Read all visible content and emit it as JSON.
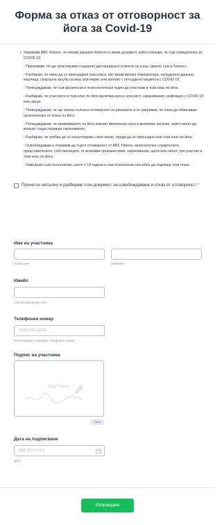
{
  "form": {
    "title": "Форма за отказ от отговорност за йога за Covid-19",
    "waiver": [
      "Уверявам ABC Fitness, че нямам заразни болести и имам документ, който показва, че съм отрицателен за COVID-19.",
      "- Признавам, че ще практикувам социално дистанциране и миене на ръце, докато съм в близост.",
      "- Разбирам, че няма да се присъединя към класа, ако имам висока температура, затруднено дишане, кашлица, скорошна загуба на вкус или мирис или контакт с потърдени пациенти с COVID-19.",
      "- Потвърждавам, че съм физически и психологически годен да участвам в този клас по йога.",
      "- Разбирам, че участието в този клас по йога включва риск и опасност, наранявания, инфекция с COVID-19 или смърт.",
      "- Потвърждавам, че ще поема пълната отговорност за рисковете и се уверявам, че няма да обвинявам организатора от класа по йога.",
      "- Потвърждавам, че занимаването по йога изисквт физическа сила и включват рискове, които могат да влошат съществуващи наранявания.",
      "- Разбирам, че трябва да се консултирам с моя лекар, преди да се присъедня към този клас по йога.",
      "- Освобождавам и отказвам да търся отговорност от ABC Fitness, включително служителите, представителите, собствениците, от всякакви произшествия, наранявания, щети или смърт, при участие в този клас по йога.",
      "- Навършил съм пълнолетие, което е 18 години и съм психически способен да подпиша този отказ."
    ],
    "agree_label": "Прочетох напълно и разбирам този документ за освобождаване и отказ от отговорност.",
    "required_mark": "*",
    "participant_name_label": "Име на участника",
    "first_name_sublabel": "Първо име",
    "last_name_sublabel": "фамилия",
    "email_label": "Имейл",
    "email_sublabel": "example@example.com",
    "phone_label": "Телефонен номер",
    "phone_placeholder": "(000) 000-0000",
    "phone_sublabel": "Моля въведете валиден телефонен номер.",
    "signature_label": "Подпис на участника",
    "signature_placeholder": "Sign Here",
    "clear_label": "Clear",
    "date_label": "Дата на подписване",
    "date_placeholder": "MM-DD-YYYY",
    "date_sublabel": "Дата",
    "submit_label": "Изпращане"
  },
  "colors": {
    "accent": "#18bd5b",
    "required": "#f23a3c",
    "text": "#2c3345"
  }
}
